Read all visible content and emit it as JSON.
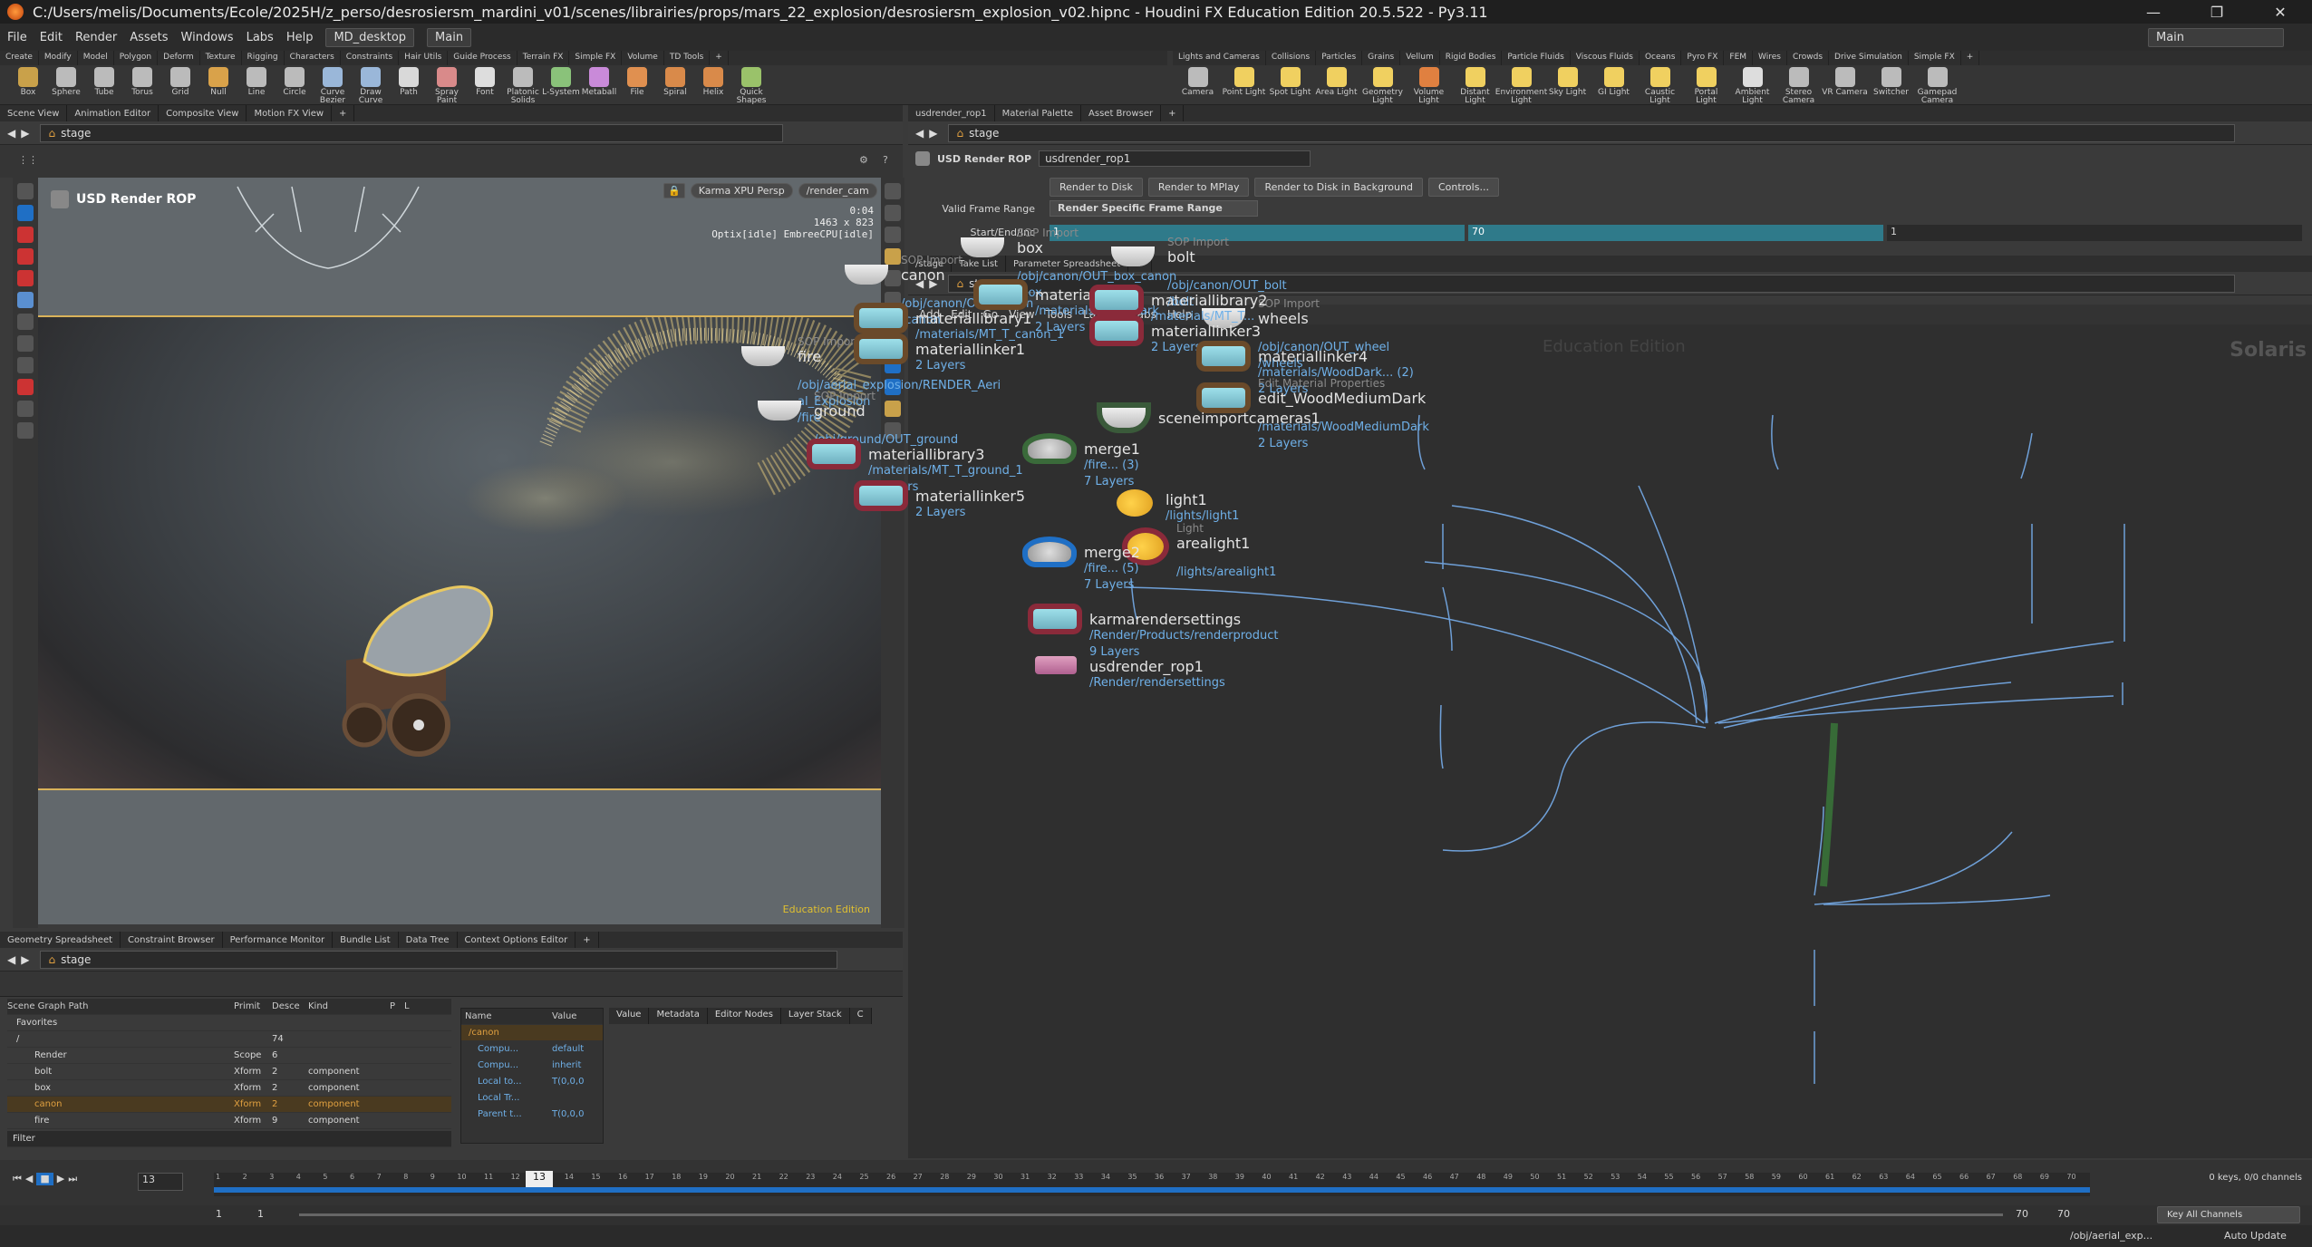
{
  "window": {
    "title": "C:/Users/melis/Documents/Ecole/2025H/z_perso/desrosiersm_mardini_v01/scenes/librairies/props/mars_22_explosion/desrosiersm_explosion_v02.hipnc - Houdini FX Education Edition 20.5.522 - Py3.11",
    "controls": [
      "—",
      "❐",
      "✕"
    ]
  },
  "menubar": {
    "items": [
      "File",
      "Edit",
      "Render",
      "Assets",
      "Windows",
      "Labs",
      "Help"
    ],
    "desktop": "MD_desktop",
    "main": "Main",
    "right_main": "Main"
  },
  "shelf": {
    "tabs_left": [
      "Create",
      "Modify",
      "Model",
      "Polygon",
      "Deform",
      "Texture",
      "Rigging",
      "Characters",
      "Constraints",
      "Hair Utils",
      "Guide Process",
      "Terrain FX",
      "Simple FX",
      "Volume",
      "TD Tools",
      "+"
    ],
    "tools_left": [
      {
        "label": "Box",
        "color": "#c9a14a"
      },
      {
        "label": "Sphere",
        "color": "#bbbbbb"
      },
      {
        "label": "Tube",
        "color": "#bbbbbb"
      },
      {
        "label": "Torus",
        "color": "#bbbbbb"
      },
      {
        "label": "Grid",
        "color": "#bbbbbb"
      },
      {
        "label": "Null",
        "color": "#d9a24a"
      },
      {
        "label": "Line",
        "color": "#bbbbbb"
      },
      {
        "label": "Circle",
        "color": "#bbbbbb"
      },
      {
        "label": "Curve Bezier",
        "color": "#9ab7d9"
      },
      {
        "label": "Draw Curve",
        "color": "#9ab7d9"
      },
      {
        "label": "Path",
        "color": "#d9d9d9"
      },
      {
        "label": "Spray Paint",
        "color": "#d98a8a"
      },
      {
        "label": "Font",
        "color": "#dddddd"
      },
      {
        "label": "Platonic Solids",
        "color": "#bbbbbb"
      },
      {
        "label": "L-System",
        "color": "#8ac27a"
      },
      {
        "label": "Metaball",
        "color": "#c98ad9"
      },
      {
        "label": "File",
        "color": "#e09050"
      },
      {
        "label": "Spiral",
        "color": "#d98a4a"
      },
      {
        "label": "Helix",
        "color": "#d98a4a"
      },
      {
        "label": "Quick Shapes",
        "color": "#9ac26a"
      }
    ],
    "tabs_right": [
      "Lights and Cameras",
      "Collisions",
      "Particles",
      "Grains",
      "Vellum",
      "Rigid Bodies",
      "Particle Fluids",
      "Viscous Fluids",
      "Oceans",
      "Pyro FX",
      "FEM",
      "Wires",
      "Crowds",
      "Drive Simulation",
      "Simple FX",
      "+"
    ],
    "tools_right": [
      {
        "label": "Camera",
        "color": "#bbbbbb"
      },
      {
        "label": "Point Light",
        "color": "#f0d060"
      },
      {
        "label": "Spot Light",
        "color": "#f0d060"
      },
      {
        "label": "Area Light",
        "color": "#f0d060"
      },
      {
        "label": "Geometry Light",
        "color": "#f0d060"
      },
      {
        "label": "Volume Light",
        "color": "#e08040"
      },
      {
        "label": "Distant Light",
        "color": "#f0d060"
      },
      {
        "label": "Environment Light",
        "color": "#f0d060"
      },
      {
        "label": "Sky Light",
        "color": "#f0d060"
      },
      {
        "label": "GI Light",
        "color": "#f0d060"
      },
      {
        "label": "Caustic Light",
        "color": "#f0d060"
      },
      {
        "label": "Portal Light",
        "color": "#f0d060"
      },
      {
        "label": "Ambient Light",
        "color": "#dddddd"
      },
      {
        "label": "Stereo Camera",
        "color": "#bbbbbb"
      },
      {
        "label": "VR Camera",
        "color": "#bbbbbb"
      },
      {
        "label": "Switcher",
        "color": "#bbbbbb"
      },
      {
        "label": "Gamepad Camera",
        "color": "#bbbbbb"
      }
    ]
  },
  "left_pane": {
    "tabs": [
      "Scene View",
      "Animation Editor",
      "Composite View",
      "Motion FX View",
      "+"
    ],
    "path": "stage",
    "viewport": {
      "rop_label": "USD Render ROP",
      "renderer": "Karma XPU Persp",
      "camera": "/render_cam",
      "time": "0:04",
      "resolution": "1463 x 823",
      "engine_status": "Optix[idle] EmbreeCPU[idle]",
      "watermark": "Education Edition"
    }
  },
  "geo_pane": {
    "tabs": [
      "Geometry Spreadsheet",
      "Constraint Browser",
      "Performance Monitor",
      "Bundle List",
      "Data Tree",
      "Context Options Editor",
      "+"
    ],
    "path": "stage",
    "headers": [
      "Scene Graph Path",
      "Primit",
      "Desce",
      "Kind",
      "P",
      "L"
    ],
    "rows": [
      {
        "path": "Favorites",
        "prim": "",
        "desc": "",
        "kind": ""
      },
      {
        "path": "/",
        "prim": "",
        "desc": "74",
        "kind": ""
      },
      {
        "path": "Render",
        "prim": "Scope",
        "desc": "6",
        "kind": ""
      },
      {
        "path": "bolt",
        "prim": "Xform",
        "desc": "2",
        "kind": "component"
      },
      {
        "path": "box",
        "prim": "Xform",
        "desc": "2",
        "kind": "component"
      },
      {
        "path": "canon",
        "prim": "Xform",
        "desc": "2",
        "kind": "component"
      },
      {
        "path": "fire",
        "prim": "Xform",
        "desc": "9",
        "kind": "component"
      }
    ],
    "filter_label": "Filter",
    "props_headers": [
      "Name",
      "Value"
    ],
    "props_root": "/canon",
    "props": [
      {
        "name": "Compu...",
        "value": "default"
      },
      {
        "name": "Compu...",
        "value": "inherit"
      },
      {
        "name": "Local to...",
        "value": "T(0,0,0"
      },
      {
        "name": "Local Tr...",
        "value": ""
      },
      {
        "name": "Parent t...",
        "value": "T(0,0,0"
      }
    ],
    "detail_tabs": [
      "Value",
      "Metadata",
      "Editor Nodes",
      "Layer Stack",
      "C"
    ]
  },
  "param_pane": {
    "tabs": [
      "usdrender_rop1",
      "Material Palette",
      "Asset Browser",
      "+"
    ],
    "path": "stage",
    "node_type": "USD Render ROP",
    "node_name": "usdrender_rop1",
    "buttons": [
      "Render to Disk",
      "Render to MPlay",
      "Render to Disk in Background",
      "Controls..."
    ],
    "valid_frame_label": "Valid Frame Range",
    "valid_frame_value": "Render Specific Frame Range",
    "start_end_label": "Start/End/Inc",
    "start": "1",
    "end": "70",
    "inc": "1"
  },
  "network_pane": {
    "tabs": [
      "/stage",
      "Take List",
      "Parameter Spreadsheet",
      "+"
    ],
    "path": "stage",
    "menu": [
      "Add",
      "Edit",
      "Go",
      "View",
      "Tools",
      "Layout",
      "Labs",
      "Help"
    ],
    "watermark": "Education Edition",
    "context_label": "Solaris",
    "nodes": {
      "box": {
        "type": "SOP Import",
        "name": "box",
        "sub1": "/obj/canon/OUT_box_canon",
        "sub2": "/box"
      },
      "bolt": {
        "type": "SOP Import",
        "name": "bolt",
        "sub1": "/obj/canon/OUT_bolt",
        "sub2": "/bolt"
      },
      "canon": {
        "type": "SOP Import",
        "name": "canon",
        "sub1": "/obj/canon/OUT_canon",
        "sub2": "/canon"
      },
      "wheels": {
        "type": "SOP Import",
        "name": "wheels",
        "sub1": "/obj/canon/OUT_wheel",
        "sub2": "/wheels"
      },
      "fire": {
        "type": "SOP Import",
        "name": "fire",
        "sub1": "/obj/aerial_explosion/RENDER_Aeri",
        "sub1b": "al_Explosion",
        "sub2": "/fire"
      },
      "ground": {
        "type": "SOP Import",
        "name": "ground",
        "sub1": "/obj/ground/OUT_ground",
        "sub2": "/ground"
      },
      "materiallinker2": {
        "name": "materiallinker2",
        "sub1": "/materials/WoodDark",
        "sub2": "2 Layers"
      },
      "materiallibrary2": {
        "name": "materiallibrary2",
        "sub1": "/materials/MT_T..."
      },
      "materiallinker3": {
        "name": "materiallinker3",
        "sub2": "2 Layers"
      },
      "materiallibrary1": {
        "name": "materiallibrary1",
        "sub1": "/materials/MT_T_canon_1"
      },
      "materiallinker1": {
        "name": "materiallinker1",
        "sub2": "2 Layers"
      },
      "materiallinker4": {
        "name": "materiallinker4",
        "sub1": "/materials/WoodDark... (2)",
        "sub2": "2 Layers"
      },
      "edit_wood": {
        "type": "Edit Material Properties",
        "name": "edit_WoodMediumDark",
        "sub1": "/materials/WoodMediumDark",
        "sub2": "2 Layers"
      },
      "scenecam": {
        "name": "sceneimportcameras1"
      },
      "materiallibrary3": {
        "name": "materiallibrary3",
        "sub1": "/materials/MT_T_ground_1",
        "sub2": "2 Layers"
      },
      "materiallinker5": {
        "name": "materiallinker5",
        "sub2": "2 Layers"
      },
      "merge1": {
        "name": "merge1",
        "sub1": "/fire... (3)",
        "sub2": "7 Layers"
      },
      "light1": {
        "name": "light1",
        "sub1": "/lights/light1"
      },
      "arealight1": {
        "type": "Light",
        "name": "arealight1",
        "sub1": "/lights/arealight1"
      },
      "merge2": {
        "name": "merge2",
        "sub1": "/fire... (5)",
        "sub2": "7 Layers"
      },
      "karma": {
        "name": "karmarendersettings",
        "sub1": "/Render/Products/renderproduct",
        "sub2": "9 Layers"
      },
      "usdrender": {
        "name": "usdrender_rop1",
        "sub1": "/Render/rendersettings"
      }
    }
  },
  "timeline": {
    "frame_field": "13",
    "current_frame": "13",
    "start_field": "1",
    "start_field2": "1",
    "end_field": "70",
    "end_field2": "70",
    "ticks": [
      "1",
      "2",
      "3",
      "4",
      "5",
      "6",
      "7",
      "8",
      "9",
      "10",
      "11",
      "12",
      "13",
      "14",
      "15",
      "16",
      "17",
      "18",
      "19",
      "20",
      "21",
      "22",
      "23",
      "24",
      "25",
      "26",
      "27",
      "28",
      "29",
      "30",
      "31",
      "32",
      "33",
      "34",
      "35",
      "36",
      "37",
      "38",
      "39",
      "40",
      "41",
      "42",
      "43",
      "44",
      "45",
      "46",
      "47",
      "48",
      "49",
      "50",
      "51",
      "52",
      "53",
      "54",
      "55",
      "56",
      "57",
      "58",
      "59",
      "60",
      "61",
      "62",
      "63",
      "64",
      "65",
      "66",
      "67",
      "68",
      "69",
      "70"
    ],
    "keys_label": "0 keys, 0/0 channels",
    "key_all_label": "Key All Channels"
  },
  "statusbar": {
    "path": "/obj/aerial_exp...",
    "auto_update": "Auto Update"
  },
  "colors": {
    "accent_blue": "#1f6fc5",
    "selection": "#d9b25a",
    "node_link": "#6fb0e8"
  }
}
